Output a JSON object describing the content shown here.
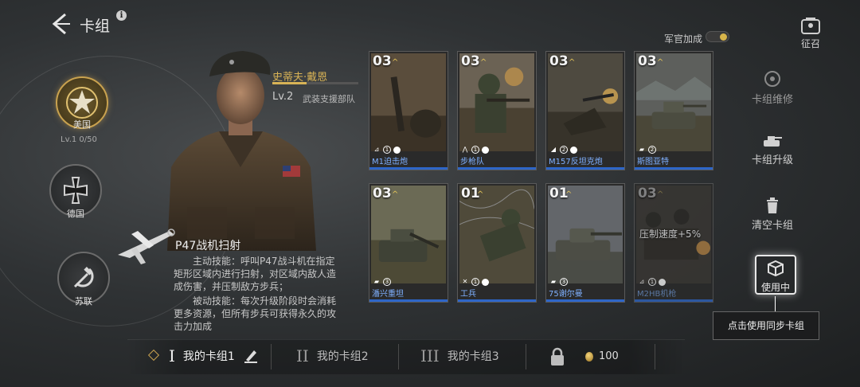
{
  "header": {
    "title": "卡组",
    "info_glyph": "i",
    "officer_label": "军官加成",
    "summon_label": "征召"
  },
  "factions": [
    {
      "label": "美国",
      "active": true
    },
    {
      "label": "德国",
      "active": false
    },
    {
      "label": "苏联",
      "active": false
    }
  ],
  "faction_level": "Lv.1  0/50",
  "commander": {
    "name": "史蒂夫·戴恩",
    "level": "Lv.2",
    "unit": "武装支援部队"
  },
  "skill": {
    "name": "P47战机扫射",
    "active": "主动技能：呼叫P47战斗机在指定矩形区域内进行扫射，对区域内敌人造成伤害，并压制敌方步兵；",
    "passive": "被动技能：每次升级阶段时会消耗更多资源，但所有步兵可获得永久的攻击力加成"
  },
  "cards": [
    {
      "cost": "03",
      "num": "1",
      "name": "M1迫击炮"
    },
    {
      "cost": "03",
      "num": "1",
      "name": "步枪队"
    },
    {
      "cost": "03",
      "num": "2",
      "name": "M157反坦克炮"
    },
    {
      "cost": "03",
      "num": "2",
      "name": "斯图亚特"
    },
    {
      "cost": "03",
      "num": "3",
      "name": "潘兴重坦"
    },
    {
      "cost": "01",
      "num": "1",
      "name": "工兵"
    },
    {
      "cost": "01",
      "num": "3",
      "name": "75谢尔曼"
    },
    {
      "cost": "03",
      "num": "1",
      "name": "M2HB机枪",
      "overlay": "压制速度+5%"
    }
  ],
  "actions": {
    "repair": "卡组维修",
    "upgrade": "卡组升级",
    "clear": "清空卡组",
    "in_use": "使用中",
    "tooltip": "点击使用同步卡组"
  },
  "decks": [
    {
      "roman": "I",
      "label": "我的卡组1",
      "active": true
    },
    {
      "roman": "II",
      "label": "我的卡组2",
      "active": false
    },
    {
      "roman": "III",
      "label": "我的卡组3",
      "active": false
    }
  ],
  "currency": "100",
  "colors": {
    "accent": "#d8b356",
    "card_bar": "#2e66c8",
    "card_name": "#7fb0ff"
  }
}
